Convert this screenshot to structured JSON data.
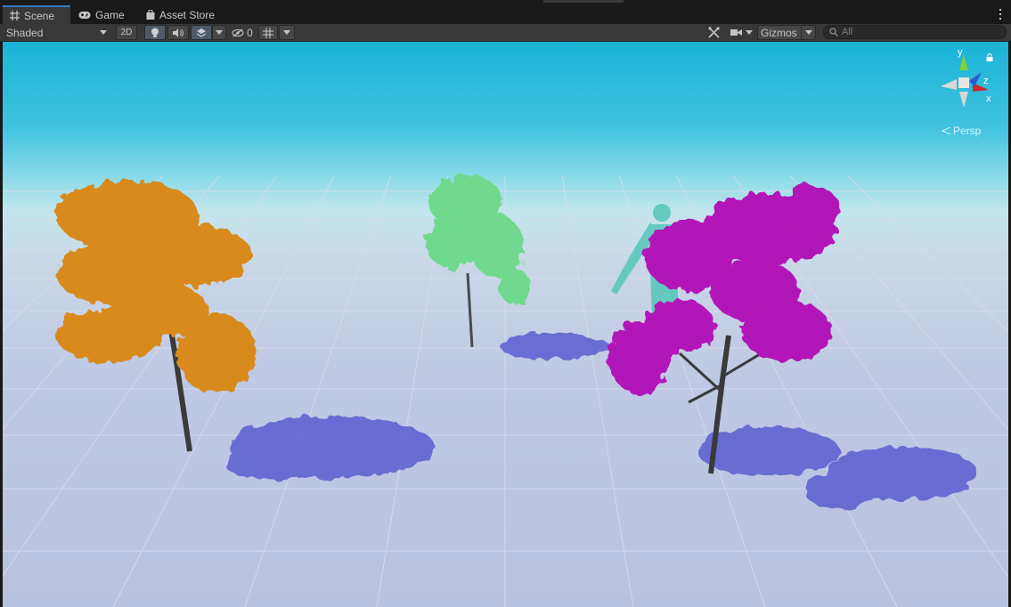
{
  "tabs": [
    {
      "label": "Scene",
      "icon": "grid-icon",
      "active": true
    },
    {
      "label": "Game",
      "icon": "gamepad-icon",
      "active": false
    },
    {
      "label": "Asset Store",
      "icon": "bag-icon",
      "active": false
    }
  ],
  "toolbar": {
    "draw_mode": "Shaded",
    "mode_2d": "2D",
    "hidden_count": "0",
    "gizmos_label": "Gizmos",
    "search_placeholder": "All",
    "icons": [
      "lightbulb-icon",
      "speaker-icon",
      "effects-icon",
      "eye-slash-icon",
      "grid-snap-icon",
      "tools-icon",
      "camera-icon",
      "search-icon"
    ]
  },
  "viewport": {
    "projection_label": "Persp",
    "axes": {
      "y": "y",
      "z": "z",
      "x": "x"
    },
    "tree_colors": {
      "orange": "#d88a1a",
      "green": "#6fd98e",
      "magenta": "#b316b8"
    },
    "character_color": "#5fc9c0"
  }
}
